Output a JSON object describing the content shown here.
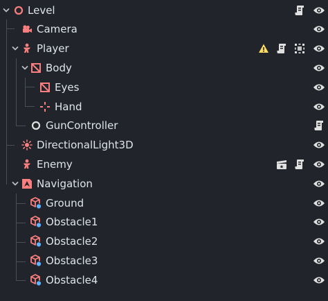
{
  "colors": {
    "background": "#21252b",
    "text": "#dfe3ea",
    "node_red": "#fc7f7f",
    "warning": "#ffdd65",
    "badge_blue": "#5fb2ff",
    "icon_light": "#e0e0e0"
  },
  "tree": {
    "nodes": [
      {
        "label": "Level",
        "icon": "node-circle-icon",
        "expanded": true,
        "badges": [
          "script-icon"
        ]
      },
      {
        "label": "Camera",
        "icon": "camera-icon",
        "badges": []
      },
      {
        "label": "Player",
        "icon": "character-body-icon",
        "expanded": true,
        "badges": [
          "warning-icon",
          "script-icon",
          "group-icon"
        ]
      },
      {
        "label": "Body",
        "icon": "node3d-box-icon",
        "expanded": true,
        "badges": []
      },
      {
        "label": "Eyes",
        "icon": "node3d-box-icon",
        "badges": []
      },
      {
        "label": "Hand",
        "icon": "marker3d-icon",
        "badges": []
      },
      {
        "label": "GunController",
        "icon": "node-circle-icon",
        "badges": [
          "script-icon"
        ]
      },
      {
        "label": "DirectionalLight3D",
        "icon": "sun-light-icon",
        "badges": []
      },
      {
        "label": "Enemy",
        "icon": "character-body-icon",
        "badges": [
          "scene-instance-icon",
          "script-icon"
        ]
      },
      {
        "label": "Navigation",
        "icon": "navigation-region-icon",
        "expanded": true,
        "badges": []
      },
      {
        "label": "Ground",
        "icon": "mesh-instance-icon",
        "badges": []
      },
      {
        "label": "Obstacle1",
        "icon": "mesh-instance-icon",
        "badges": []
      },
      {
        "label": "Obstacle2",
        "icon": "mesh-instance-icon",
        "badges": []
      },
      {
        "label": "Obstacle3",
        "icon": "mesh-instance-icon",
        "badges": []
      },
      {
        "label": "Obstacle4",
        "icon": "mesh-instance-icon",
        "badges": []
      }
    ]
  }
}
